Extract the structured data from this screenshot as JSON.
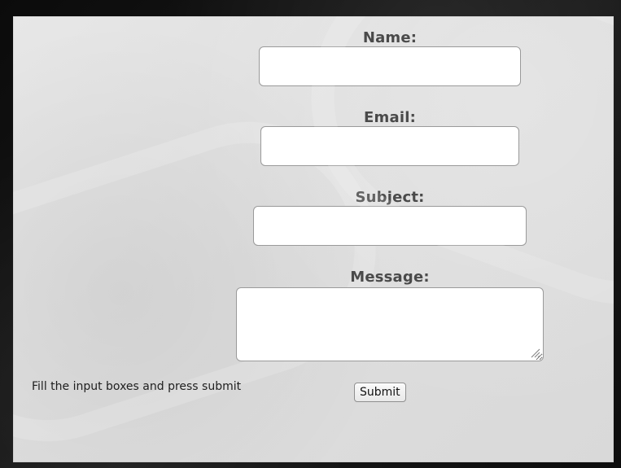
{
  "form": {
    "name_label": "Name:",
    "email_label": "Email:",
    "subject_label": "Subject:",
    "message_label": "Message:",
    "name_value": "",
    "email_value": "",
    "subject_value": "",
    "message_value": "",
    "hint_text": "Fill the input boxes and press submit",
    "submit_label": "Submit"
  }
}
